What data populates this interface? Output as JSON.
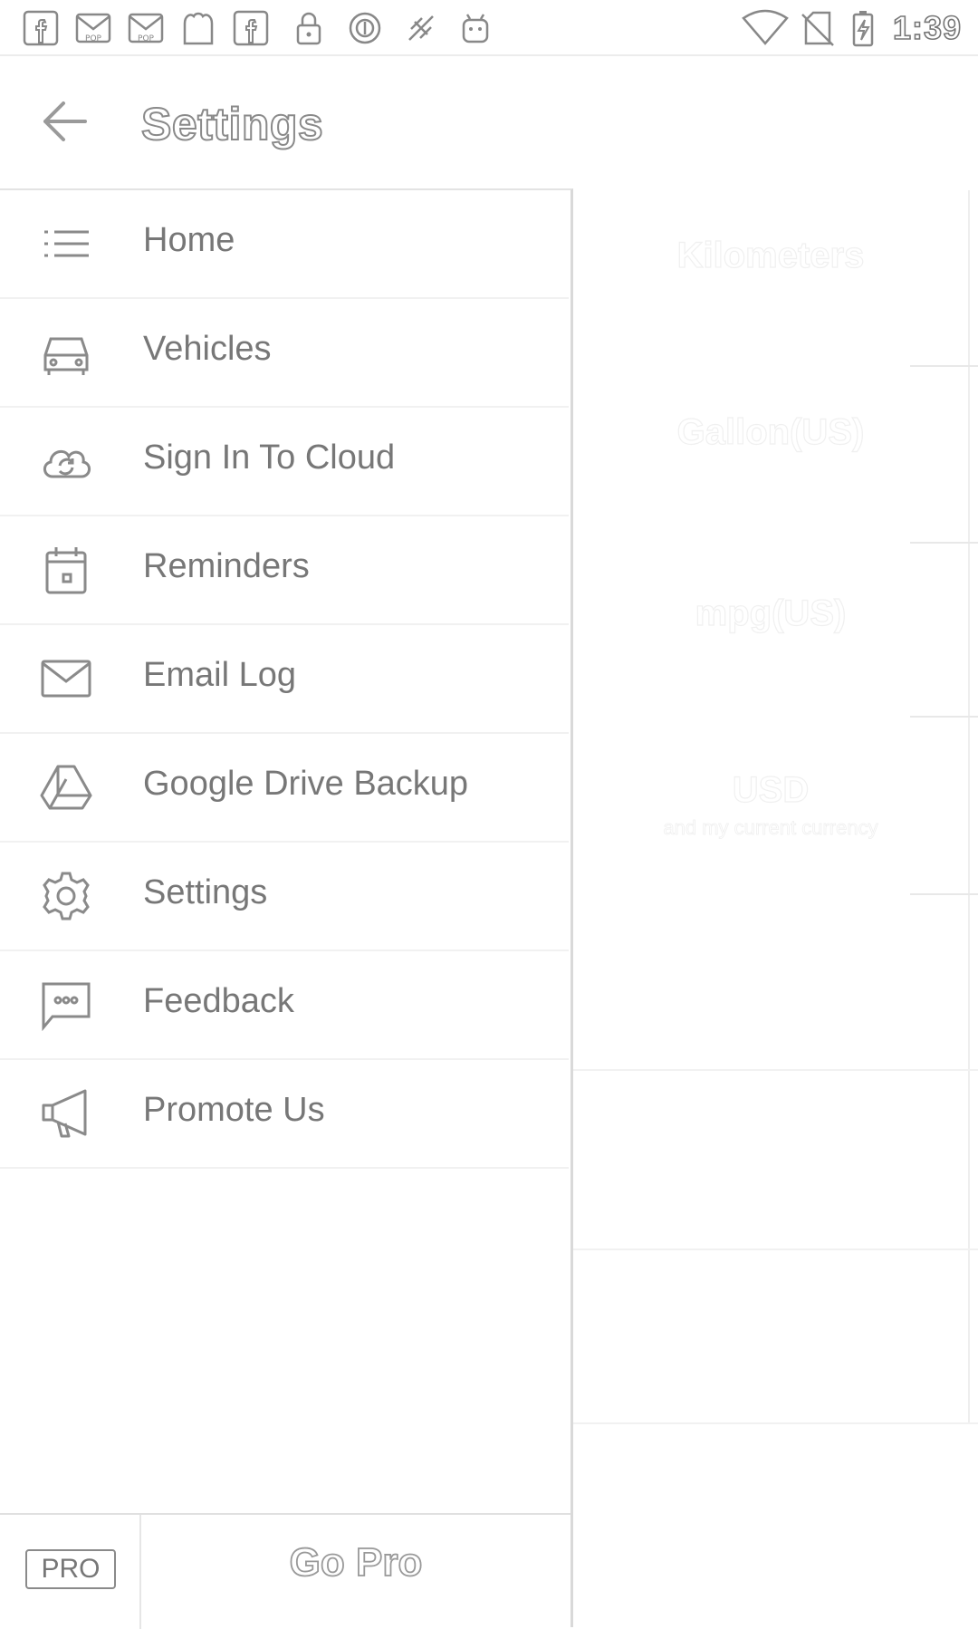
{
  "status_bar": {
    "time": "1:39",
    "notification_icons": [
      "facebook-icon",
      "mail-icon",
      "mail-icon",
      "app-icon",
      "facebook-icon",
      "lock-icon",
      "circle-icon",
      "satellite-icon",
      "android-icon"
    ],
    "system_icons": [
      "wifi-icon",
      "no-sim-icon",
      "battery-charging-icon"
    ]
  },
  "app_bar": {
    "title": "Settings",
    "back_icon": "arrow-back-icon"
  },
  "background": {
    "items": [
      {
        "value": "Kilometers",
        "sub": ""
      },
      {
        "value": "Gallon(US)",
        "sub": ""
      },
      {
        "value": "mpg(US)",
        "sub": ""
      },
      {
        "value": "USD",
        "sub": "and my current currency"
      }
    ]
  },
  "drawer": {
    "items": [
      {
        "label": "Home",
        "icon": "list-icon"
      },
      {
        "label": "Vehicles",
        "icon": "car-icon"
      },
      {
        "label": "Sign In To Cloud",
        "icon": "cloud-sync-icon"
      },
      {
        "label": "Reminders",
        "icon": "calendar-icon"
      },
      {
        "label": "Email Log",
        "icon": "envelope-icon"
      },
      {
        "label": "Google Drive Backup",
        "icon": "google-drive-icon"
      },
      {
        "label": "Settings",
        "icon": "gear-icon"
      },
      {
        "label": "Feedback",
        "icon": "chat-bubble-icon"
      },
      {
        "label": "Promote Us",
        "icon": "megaphone-icon"
      }
    ],
    "footer": {
      "badge": "PRO",
      "action": "Go Pro"
    }
  }
}
